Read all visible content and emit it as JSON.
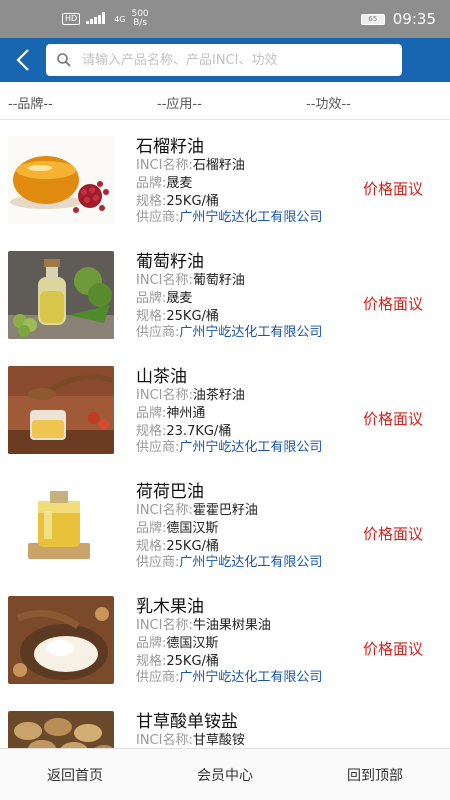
{
  "status_bar": {
    "network_badge": "HD",
    "signal": "4G",
    "speed_value": "500",
    "speed_unit": "B/s",
    "battery": "65",
    "time": "09:35"
  },
  "header": {
    "search_placeholder": "请输入产品名称、产品INCI、功效"
  },
  "filters": {
    "brand": "--品牌--",
    "application": "--应用--",
    "efficacy": "--功效--"
  },
  "labels": {
    "inci": "INCI名称:",
    "brand": "品牌:",
    "spec": "规格:",
    "supplier": "供应商:"
  },
  "products": [
    {
      "name": "石榴籽油",
      "inci": "石榴籽油",
      "brand": "晟麦",
      "spec": "25KG/桶",
      "supplier": "广州宁屹达化工有限公司",
      "price": "价格面议",
      "image": "pomegranate-oil"
    },
    {
      "name": "葡萄籽油",
      "inci": "葡萄籽油",
      "brand": "晟麦",
      "spec": "25KG/桶",
      "supplier": "广州宁屹达化工有限公司",
      "price": "价格面议",
      "image": "grapeseed-oil"
    },
    {
      "name": "山茶油",
      "inci": "油茶籽油",
      "brand": "神州通",
      "spec": "23.7KG/桶",
      "supplier": "广州宁屹达化工有限公司",
      "price": "价格面议",
      "image": "camellia-oil"
    },
    {
      "name": "荷荷巴油",
      "inci": "霍霍巴籽油",
      "brand": "德国汉斯",
      "spec": "25KG/桶",
      "supplier": "广州宁屹达化工有限公司",
      "price": "价格面议",
      "image": "jojoba-oil"
    },
    {
      "name": "乳木果油",
      "inci": "牛油果树果油",
      "brand": "德国汉斯",
      "spec": "25KG/桶",
      "supplier": "广州宁屹达化工有限公司",
      "price": "价格面议",
      "image": "shea-butter"
    },
    {
      "name": "甘草酸单铵盐",
      "inci": "甘草酸铵",
      "image": "licorice-root"
    }
  ],
  "bottom_nav": {
    "home": "返回首页",
    "member": "会员中心",
    "top": "回到顶部"
  },
  "colors": {
    "header": "#1865b0",
    "price": "#d2231d",
    "supplier": "#1a56a8"
  }
}
